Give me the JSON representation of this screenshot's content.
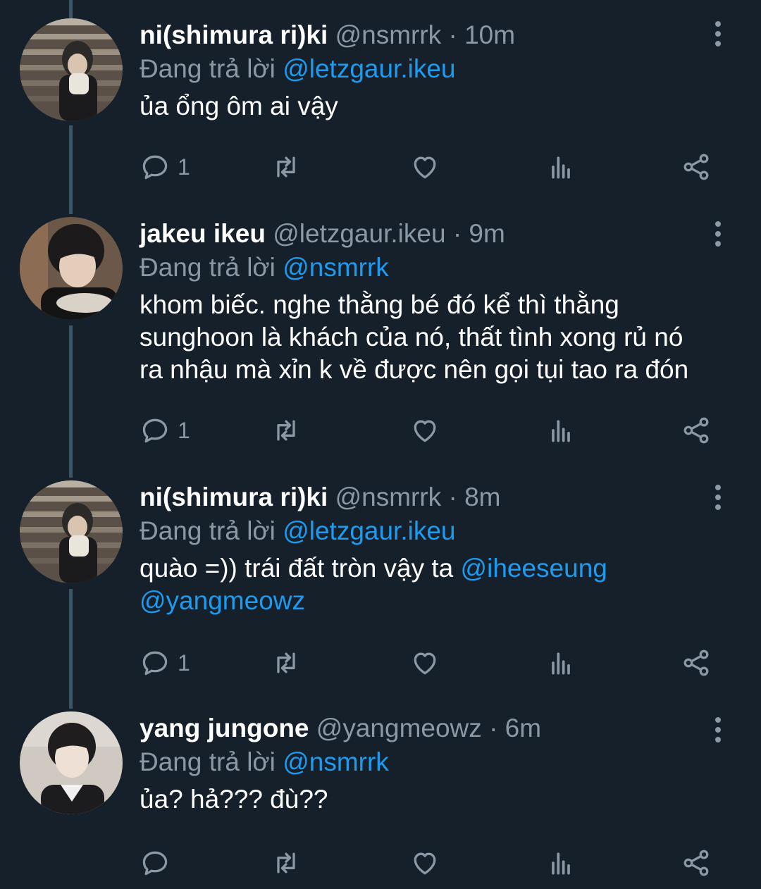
{
  "tweets": [
    {
      "name": "ni(shimura ri)ki",
      "handle": "@nsmrrk",
      "time": "10m",
      "reply_prefix": "Đang trả lời",
      "reply_to": "@letzgaur.ikeu",
      "text": "ủa ổng ôm ai vậy",
      "mentions": "",
      "reply_count": "1"
    },
    {
      "name": "jakeu ikeu",
      "handle": "@letzgaur.ikeu",
      "time": "9m",
      "reply_prefix": "Đang trả lời",
      "reply_to": "@nsmrrk",
      "text": "khom biếc. nghe thằng bé đó kể thì thằng sunghoon là khách của nó, thất tình xong rủ nó ra nhậu mà xỉn k về được nên gọi tụi tao ra đón",
      "mentions": "",
      "reply_count": "1"
    },
    {
      "name": "ni(shimura ri)ki",
      "handle": "@nsmrrk",
      "time": "8m",
      "reply_prefix": "Đang trả lời",
      "reply_to": "@letzgaur.ikeu",
      "text": "quào =)) trái đất tròn vậy ta ",
      "mention_1": "@iheeseung",
      "mention_2": "@yangmeowz",
      "reply_count": "1"
    },
    {
      "name": "yang jungone",
      "handle": "@yangmeowz",
      "time": "6m",
      "reply_prefix": "Đang trả lời",
      "reply_to": "@nsmrrk",
      "text": "ủa? hả??? đù??",
      "mentions": "",
      "reply_count": ""
    }
  ],
  "separator": "·",
  "icons": {
    "reply": "reply-icon",
    "retweet": "retweet-icon",
    "like": "heart-icon",
    "views": "analytics-icon",
    "share": "share-icon",
    "more": "more-vertical-icon"
  },
  "colors": {
    "background": "#15202b",
    "mention": "#1d9bf0",
    "muted": "#8b98a5",
    "thread_line": "#3d5466"
  }
}
